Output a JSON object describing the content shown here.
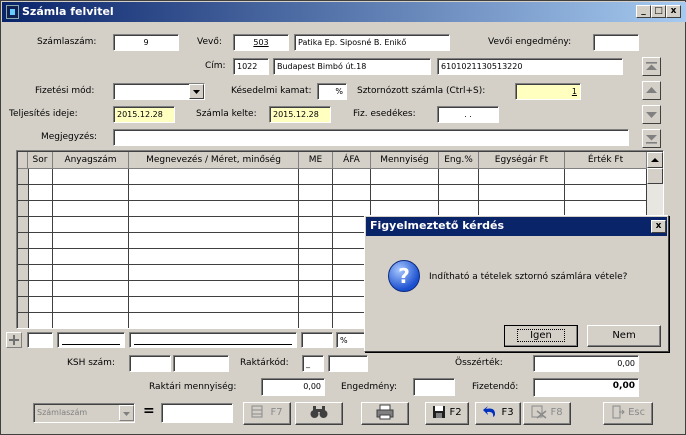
{
  "window": {
    "title": "Számla felvitel",
    "controls": [
      "_",
      "□",
      "x"
    ]
  },
  "header": {
    "szamlaszam_label": "Számlaszám:",
    "szamlaszam_value": "9",
    "vevo_label": "Vevő:",
    "vevo_code": "503",
    "vevo_name": "Patika Ep. Siposné B. Enikő",
    "vevoi_engedmeny_label": "Vevői engedmény:",
    "vevoi_engedmeny_value": "",
    "cim_label": "Cím:",
    "cim_zip": "1022",
    "cim_street": "Budapest Bimbó út.18",
    "cim_account": "6101021130513220",
    "fizetesi_mod_label": "Fizetési mód:",
    "fizetesi_mod_value": "",
    "kesedelmi_kamat_label": "Késedelmi kamat:",
    "kesedelmi_kamat_value": "%",
    "sztornozott_label": "Sztornózott számla (Ctrl+S):",
    "sztornozott_value": "1",
    "teljesites_label": "Teljesítés ideje:",
    "teljesites_value": "2015.12.28",
    "szamla_kelte_label": "Számla kelte:",
    "szamla_kelte_value": "2015.12.28",
    "fiz_esedekes_label": "Fiz. esedékes:",
    "fiz_esedekes_value": ". .",
    "megjegyzes_label": "Megjegyzés:",
    "megjegyzes_value": ""
  },
  "grid": {
    "columns": [
      "Sor",
      "Anyagszám",
      "Megnevezés / Méret, minőség",
      "ME",
      "ÁFA",
      "Mennyiség",
      "Eng.%",
      "Egységár Ft",
      "Érték Ft"
    ],
    "add_row": {
      "afa_value": "%"
    }
  },
  "footer": {
    "ksh_label": "KSH szám:",
    "raktarkod_label": "Raktárkód:",
    "raktarkod_value": "_",
    "osszertek_label": "Összérték:",
    "osszertek_value": "0,00",
    "raktari_mennyiseg_label": "Raktári mennyiség:",
    "raktari_mennyiseg_value": "0,00",
    "engedmeny_label": "Engedmény:",
    "engedmeny_value": "",
    "fizetendo_label": "Fizetendő:",
    "fizetendo_value": "0,00"
  },
  "toolbar": {
    "search_field": "Számlaszám",
    "equals": "=",
    "search_value": "",
    "f7_label": "F7",
    "f2_label": "F2",
    "f3_label": "F3",
    "f8_label": "F8",
    "esc_label": "Esc"
  },
  "dialog": {
    "title": "Figyelmeztető kérdés",
    "message": "Indítható a tételek sztornó számlára vétele?",
    "yes_label": "Igen",
    "no_label": "Nem",
    "close": "x",
    "icon_glyph": "?"
  }
}
